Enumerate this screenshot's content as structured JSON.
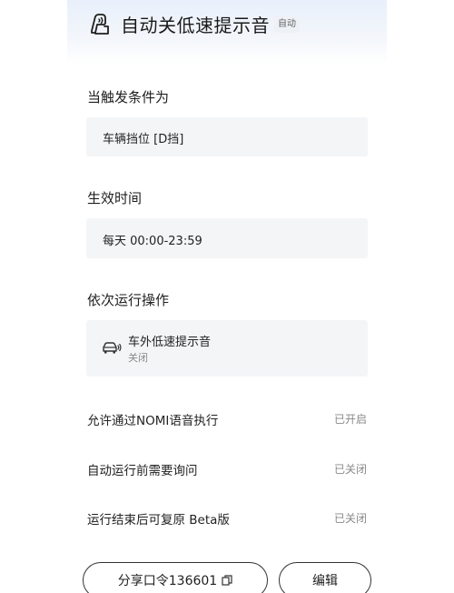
{
  "header": {
    "title": "自动关低速提示音",
    "tag": "自动",
    "icon": "seat-sound-icon"
  },
  "trigger": {
    "title": "当触发条件为",
    "value": "车辆挡位 [D挡]"
  },
  "effective_time": {
    "title": "生效时间",
    "value": "每天 00:00-23:59"
  },
  "actions": {
    "title": "依次运行操作",
    "items": [
      {
        "name": "车外低速提示音",
        "state": "关闭",
        "icon": "car-sound-icon"
      }
    ]
  },
  "settings": [
    {
      "label": "允许通过NOMI语音执行",
      "value": "已开启"
    },
    {
      "label": "自动运行前需要询问",
      "value": "已关闭"
    },
    {
      "label": "运行结束后可复原 Beta版",
      "value": "已关闭"
    }
  ],
  "buttons": {
    "share_label": "分享口令136601",
    "edit_label": "编辑"
  },
  "colors": {
    "header_gradient_top": "#e9f0fb",
    "box_background": "#f4f5f7",
    "muted_text": "#8a8a8a"
  }
}
